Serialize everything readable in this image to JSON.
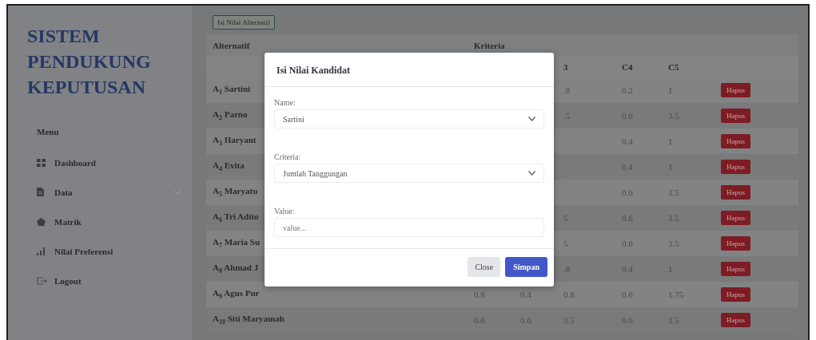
{
  "sidebar": {
    "title": "SISTEM PENDUKUNG KEPUTUSAN",
    "menu_heading": "Menu",
    "items": [
      {
        "label": "Dashboard",
        "kind": "link"
      },
      {
        "label": "Data",
        "kind": "dropdown"
      },
      {
        "label": "Matrik",
        "kind": "link"
      },
      {
        "label": "Nilai Preferensi",
        "kind": "link"
      },
      {
        "label": "Logout",
        "kind": "link"
      }
    ]
  },
  "main": {
    "add_button": "Isi Nilai Alternatif",
    "table": {
      "header_alternative": "Alternatif",
      "header_criteria": "Kriteria",
      "criteria_headers": {
        "c3": "3",
        "c4": "C4",
        "c5": "C5"
      },
      "rows": [
        {
          "name": "A$_{1}$ Sartini",
          "c3": ".8",
          "c4": "0.2",
          "c5": "1",
          "action": "Hapus"
        },
        {
          "name": "A$_{2}$ Parno",
          "c3": ".5",
          "c4": "0.6",
          "c5": "3.5",
          "action": "Hapus"
        },
        {
          "name": "A$_{3}$ Haryant",
          "c4": "0.4",
          "c5": "1",
          "action": "Hapus"
        },
        {
          "name": "A$_{4}$ Evita",
          "c4": "0.4",
          "c5": "1",
          "action": "Hapus"
        },
        {
          "name": "A$_{5}$ Maryatu",
          "c4": "0.6",
          "c5": "3.5",
          "action": "Hapus"
        },
        {
          "name": "A$_{6}$ Tri Adito",
          "c3": "5",
          "c4": "0.6",
          "c5": "3.5",
          "action": "Hapus"
        },
        {
          "name": "A$_{7}$ Maria Su",
          "c3": "5",
          "c4": "0.6",
          "c5": "3.5",
          "action": "Hapus"
        },
        {
          "name": "A$_{8}$ Ahmad J",
          "c3": ".8",
          "c4": "0.4",
          "c5": "1",
          "action": "Hapus"
        },
        {
          "name": "A$_{9}$ Agus Pur",
          "c1": "0.8",
          "c2": "0.4",
          "c3": "0.8",
          "c4": "0.6",
          "c5": "1.75",
          "action": "Hapus"
        },
        {
          "name": "A$_{10}$ Siti Maryamah",
          "c1": "0.6",
          "c2": "0.6",
          "c3": "3.5",
          "c4": "0.6",
          "c5": "3.5",
          "action": "Hapus"
        }
      ]
    }
  },
  "modal": {
    "title": "Isi Nilai Kandidat",
    "fields": [
      {
        "label": "Name:",
        "kind": "select",
        "value": "Sartini"
      },
      {
        "label": "Criteria:",
        "kind": "select",
        "value": "Jumlah Tanggungan"
      },
      {
        "label": "Value:",
        "kind": "input",
        "placeholder": "value..."
      }
    ],
    "buttons": [
      {
        "label": "Close",
        "kind": "secondary"
      },
      {
        "label": "Simpan",
        "kind": "primary"
      }
    ]
  }
}
